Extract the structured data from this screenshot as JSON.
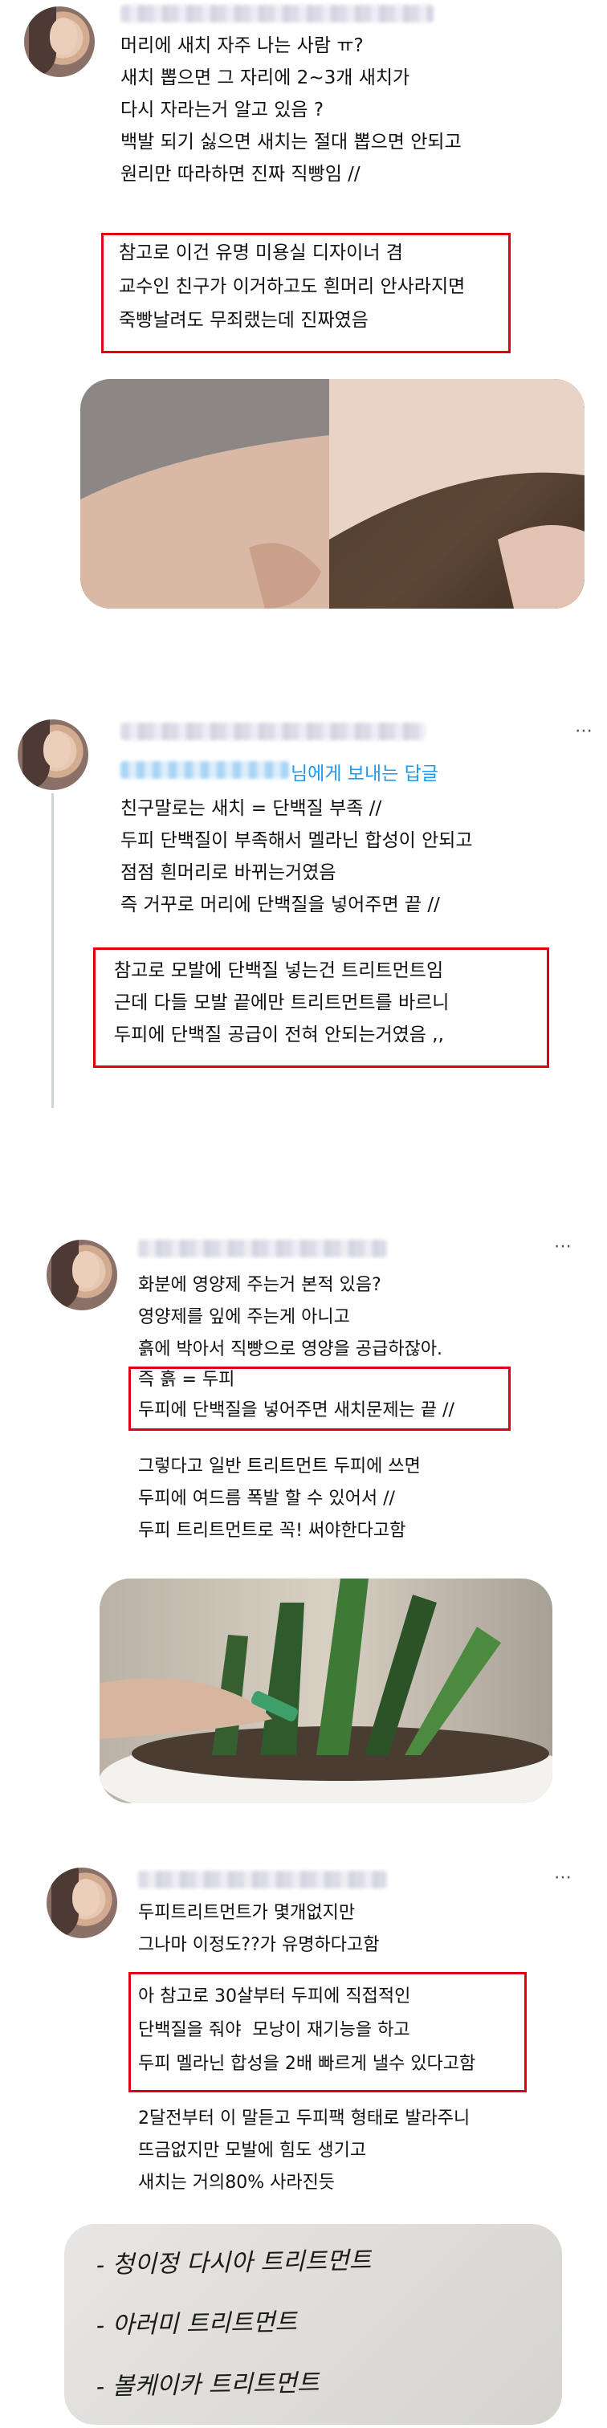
{
  "posts": [
    {
      "lines": [
        "머리에 새치 자주 나는 사람 ㅠ?",
        "새치 뽑으면 그 자리에 2~3개 새치가",
        "다시 자라는거 알고 있음 ?",
        "백발 되기 싫으면 새치는 절대 뽑으면 안되고",
        "원리만 따라하면 진짜 직빵임 //"
      ],
      "boxed": [
        "참고로 이건 유명 미용실 디자이너 겸",
        "교수인 친구가 이거하고도 흰머리 안사라지면",
        "죽빵날려도 무죄랬는데 진짜였음"
      ]
    },
    {
      "reply_to": "님에게 보내는 답글",
      "lines": [
        "친구말로는 새치 = 단백질 부족 //",
        "두피 단백질이 부족해서 멜라닌 합성이 안되고",
        "점점 흰머리로 바뀌는거였음",
        "즉 거꾸로 머리에 단백질을 넣어주면 끝 //"
      ],
      "boxed": [
        "참고로 모발에 단백질 넣는건 트리트먼트임",
        "근데 다들 모발 끝에만 트리트먼트를 바르니",
        "두피에 단백질 공급이 전혀 안되는거였음 ,,"
      ]
    },
    {
      "lines": [
        "화분에 영양제 주는거 본적 있음?",
        "영양제를 잎에 주는게 아니고",
        "흙에 박아서 직빵으로 영양을 공급하잖아."
      ],
      "boxed": [
        "즉 흙 = 두피",
        "두피에 단백질을 넣어주면 새치문제는 끝 //"
      ],
      "after": [
        "그렇다고 일반 트리트먼트 두피에 쓰면",
        "두피에 여드름 폭발 할 수 있어서 //",
        "두피 트리트먼트로 꼭! 써야한다고함"
      ]
    },
    {
      "lines": [
        "두피트리트먼트가 몇개없지만",
        "그나마 이정도??가 유명하다고함"
      ],
      "boxed": [
        "아 참고로 30살부터 두피에 직접적인",
        "단백질을 줘야  모낭이 재기능을 하고",
        "두피 멜라닌 합성을 2배 빠르게 낼수 있다고함"
      ],
      "after": [
        "2달전부터 이 말듣고 두피팩 형태로 발라주니",
        "뜨금없지만 모발에 힘도 생기고",
        "새치는 거의80% 사라진듯"
      ]
    }
  ],
  "handwritten_note": [
    "- 청이정 다시아 트리트먼트",
    "- 아러미 트리트먼트",
    "- 볼케이카 트리트먼트"
  ],
  "more_icon": "more-horizontal-icon",
  "colors": {
    "red_box": "#e00012",
    "reply_link": "#1d9bf0",
    "thread": "#cfd3d8"
  }
}
